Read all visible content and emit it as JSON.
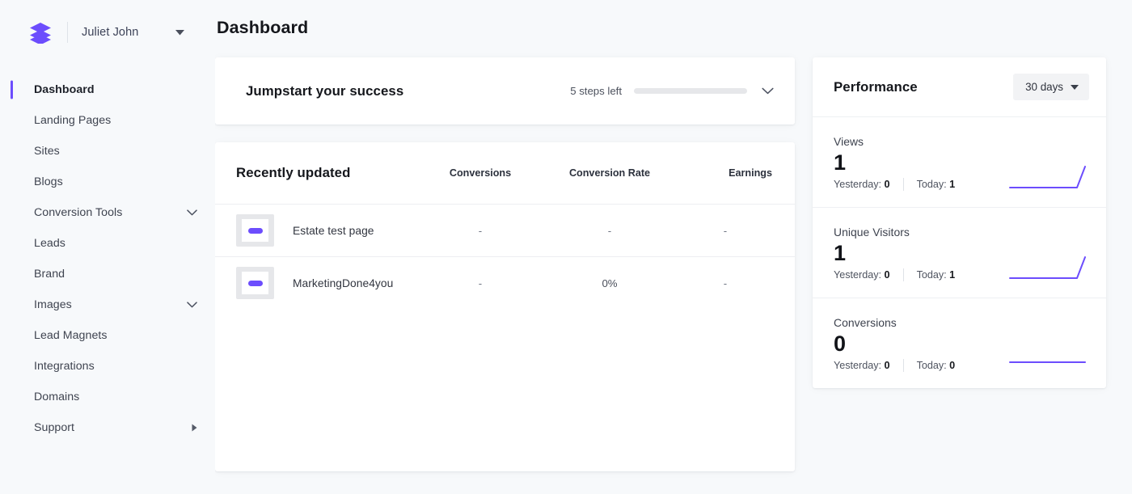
{
  "brand": {
    "logo_icon": "layers-stack-icon",
    "account_name": "Juliet John",
    "caret_icon": "caret-down-icon"
  },
  "sidebar": {
    "items": [
      {
        "label": "Dashboard",
        "active": true,
        "icon": null
      },
      {
        "label": "Landing Pages",
        "active": false,
        "icon": null
      },
      {
        "label": "Sites",
        "active": false,
        "icon": null
      },
      {
        "label": "Blogs",
        "active": false,
        "icon": null
      },
      {
        "label": "Conversion Tools",
        "active": false,
        "icon": "chevron-down-icon"
      },
      {
        "label": "Leads",
        "active": false,
        "icon": null
      },
      {
        "label": "Brand",
        "active": false,
        "icon": null
      },
      {
        "label": "Images",
        "active": false,
        "icon": "chevron-down-icon"
      },
      {
        "label": "Lead Magnets",
        "active": false,
        "icon": null
      },
      {
        "label": "Integrations",
        "active": false,
        "icon": null
      },
      {
        "label": "Domains",
        "active": false,
        "icon": null
      },
      {
        "label": "Support",
        "active": false,
        "icon": "caret-right-icon"
      }
    ]
  },
  "header": {
    "title": "Dashboard"
  },
  "jumpstart": {
    "title": "Jumpstart your success",
    "steps_left": "5 steps left",
    "progress_percent": 0,
    "chevron_icon": "chevron-down-icon"
  },
  "recent": {
    "title": "Recently updated",
    "columns": [
      "Conversions",
      "Conversion Rate",
      "Earnings"
    ],
    "rows": [
      {
        "name": "Estate test page",
        "conversions": "-",
        "conversion_rate": "-",
        "earnings": "-"
      },
      {
        "name": "MarketingDone4you",
        "conversions": "-",
        "conversion_rate": "0%",
        "earnings": "-"
      }
    ]
  },
  "performance": {
    "title": "Performance",
    "range_label": "30 days",
    "range_caret_icon": "caret-down-icon",
    "metrics": [
      {
        "label": "Views",
        "value": "1",
        "yesterday_label": "Yesterday:",
        "yesterday_value": "0",
        "today_label": "Today:",
        "today_value": "1",
        "spark": "rise-at-end"
      },
      {
        "label": "Unique Visitors",
        "value": "1",
        "yesterday_label": "Yesterday:",
        "yesterday_value": "0",
        "today_label": "Today:",
        "today_value": "1",
        "spark": "rise-at-end"
      },
      {
        "label": "Conversions",
        "value": "0",
        "yesterday_label": "Yesterday:",
        "yesterday_value": "0",
        "today_label": "Today:",
        "today_value": "0",
        "spark": "flat"
      }
    ]
  },
  "colors": {
    "accent": "#6c4dfd",
    "page_bg": "#f7f9fb",
    "card_bg": "#ffffff",
    "text_primary": "#15171c",
    "text_muted": "#4c515d",
    "divider": "#eef0f3"
  }
}
